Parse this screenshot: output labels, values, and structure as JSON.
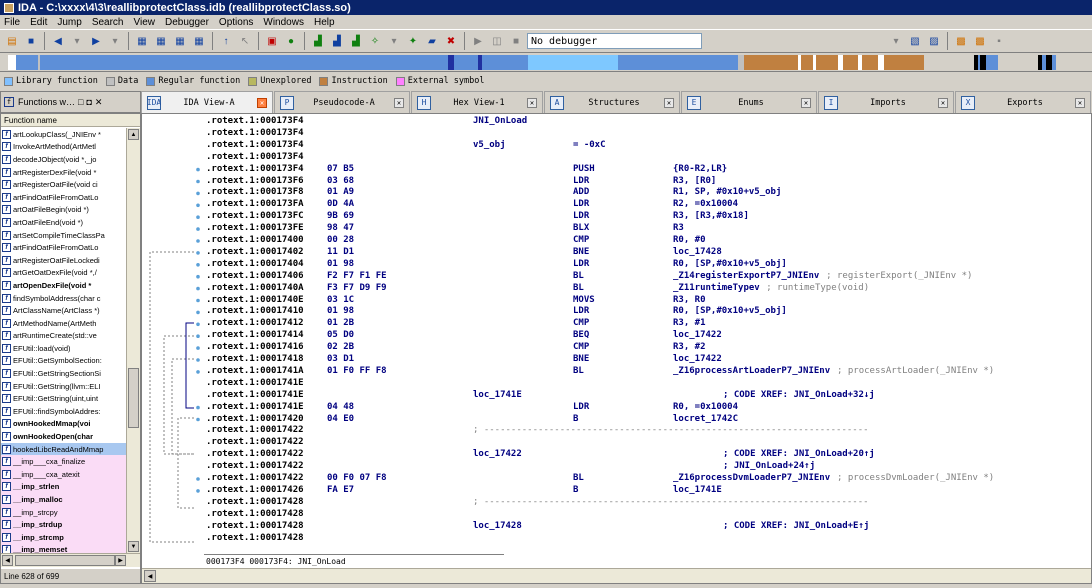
{
  "window": {
    "title": "IDA - C:\\xxxx\\4\\3\\reallibprotectClass.idb (reallibprotectClass.so)"
  },
  "menu": [
    "File",
    "Edit",
    "Jump",
    "Search",
    "View",
    "Debugger",
    "Options",
    "Windows",
    "Help"
  ],
  "toolbar": {
    "debugger_select": "No debugger"
  },
  "legend": [
    {
      "label": "Library function",
      "color": "#80c0ff"
    },
    {
      "label": "Data",
      "color": "#c0c0c0"
    },
    {
      "label": "Regular function",
      "color": "#5d8fd8"
    },
    {
      "label": "Unexplored",
      "color": "#b8b860"
    },
    {
      "label": "Instruction",
      "color": "#c08040"
    },
    {
      "label": "External symbol",
      "color": "#ff80ff"
    }
  ],
  "functions_panel": {
    "title": "Functions w…",
    "column": "Function name",
    "status": "Line 628 of 699",
    "items": [
      {
        "name": "artLookupClass(_JNIEnv *",
        "style": ""
      },
      {
        "name": "InvokeArtMethod(ArtMetl",
        "style": ""
      },
      {
        "name": "decodeJObject(void *,_jo",
        "style": ""
      },
      {
        "name": "artRegisterDexFile(void *",
        "style": ""
      },
      {
        "name": "artRegisterOatFile(void ci",
        "style": ""
      },
      {
        "name": "artFindOatFileFromOatLo",
        "style": ""
      },
      {
        "name": "artOatFileBegin(void *)",
        "style": ""
      },
      {
        "name": "artOatFileEnd(void *)",
        "style": ""
      },
      {
        "name": "artSetCompileTimeClassPa",
        "style": ""
      },
      {
        "name": "artFindOatFileFromOatLo",
        "style": ""
      },
      {
        "name": "artRegisterOatFileLockedi",
        "style": ""
      },
      {
        "name": "artGetOatDexFile(void *,/",
        "style": ""
      },
      {
        "name": "artOpenDexFile(void *",
        "style": "bold"
      },
      {
        "name": "findSymbolAddress(char c",
        "style": ""
      },
      {
        "name": "ArtClassName(ArtClass *)",
        "style": ""
      },
      {
        "name": "ArtMethodName(ArtMeth",
        "style": ""
      },
      {
        "name": "artRuntimeCreate(std::ve",
        "style": ""
      },
      {
        "name": "EFUtil::load(void)",
        "style": ""
      },
      {
        "name": "EFUtil::GetSymbolSection:",
        "style": ""
      },
      {
        "name": "EFUtil::GetStringSectionSi",
        "style": ""
      },
      {
        "name": "EFUtil::GetString(llvm::ELI",
        "style": ""
      },
      {
        "name": "EFUtil::GetString(uint,uint",
        "style": ""
      },
      {
        "name": "EFUtil::findSymbolAddres:",
        "style": ""
      },
      {
        "name": "ownHookedMmap(voi",
        "style": "bold"
      },
      {
        "name": "ownHookedOpen(char",
        "style": "bold"
      },
      {
        "name": "hookedLibcReadAndMmap",
        "style": "sel"
      },
      {
        "name": "__imp___cxa_finalize",
        "style": "lib"
      },
      {
        "name": "__imp___cxa_atexit",
        "style": "lib"
      },
      {
        "name": "__imp_strlen",
        "style": "lib bold"
      },
      {
        "name": "__imp_malloc",
        "style": "lib bold"
      },
      {
        "name": "__imp_strcpy",
        "style": "lib"
      },
      {
        "name": "__imp_strdup",
        "style": "lib bold"
      },
      {
        "name": "__imp_strcmp",
        "style": "lib bold"
      },
      {
        "name": "__imp_memset",
        "style": "lib bold"
      }
    ]
  },
  "tabs": [
    {
      "label": "IDA View-A",
      "icon": "IDA",
      "close_active": true
    },
    {
      "label": "Pseudocode-A",
      "icon": "P",
      "close_active": false
    },
    {
      "label": "Hex View-1",
      "icon": "H",
      "close_active": false
    },
    {
      "label": "Structures",
      "icon": "A",
      "close_active": false
    },
    {
      "label": "Enums",
      "icon": "E",
      "close_active": false
    },
    {
      "label": "Imports",
      "icon": "I",
      "close_active": false
    },
    {
      "label": "Exports",
      "icon": "X",
      "close_active": false
    }
  ],
  "disasm": [
    {
      "addr": ".rotext.1:000173F4",
      "bytes": "",
      "label": "JNI_OnLoad",
      "mn": "",
      "op": "",
      "cmt": ""
    },
    {
      "addr": ".rotext.1:000173F4",
      "bytes": "",
      "label": "",
      "mn": "",
      "op": "",
      "cmt": ""
    },
    {
      "addr": ".rotext.1:000173F4",
      "bytes": "",
      "label": "v5_obj",
      "mn": "= -0xC",
      "op": "",
      "cmt": ""
    },
    {
      "addr": ".rotext.1:000173F4",
      "bytes": "",
      "label": "",
      "mn": "",
      "op": "",
      "cmt": ""
    },
    {
      "addr": ".rotext.1:000173F4",
      "bytes": "07 B5",
      "label": "",
      "mn": "PUSH",
      "op": "{R0-R2,LR}",
      "cmt": ""
    },
    {
      "addr": ".rotext.1:000173F6",
      "bytes": "03 68",
      "label": "",
      "mn": "LDR",
      "op": "R3, [R0]",
      "cmt": ""
    },
    {
      "addr": ".rotext.1:000173F8",
      "bytes": "01 A9",
      "label": "",
      "mn": "ADD",
      "op": "R1, SP, #0x10+v5_obj",
      "cmt": ""
    },
    {
      "addr": ".rotext.1:000173FA",
      "bytes": "0D 4A",
      "label": "",
      "mn": "LDR",
      "op": "R2, =0x10004",
      "cmt": ""
    },
    {
      "addr": ".rotext.1:000173FC",
      "bytes": "9B 69",
      "label": "",
      "mn": "LDR",
      "op": "R3, [R3,#0x18]",
      "cmt": ""
    },
    {
      "addr": ".rotext.1:000173FE",
      "bytes": "98 47",
      "label": "",
      "mn": "BLX",
      "op": "R3",
      "cmt": ""
    },
    {
      "addr": ".rotext.1:00017400",
      "bytes": "00 28",
      "label": "",
      "mn": "CMP",
      "op": "R0, #0",
      "cmt": ""
    },
    {
      "addr": ".rotext.1:00017402",
      "bytes": "11 D1",
      "label": "",
      "mn": "BNE",
      "op": "loc_17428",
      "cmt": ""
    },
    {
      "addr": ".rotext.1:00017404",
      "bytes": "01 98",
      "label": "",
      "mn": "LDR",
      "op": "R0, [SP,#0x10+v5_obj]",
      "cmt": ""
    },
    {
      "addr": ".rotext.1:00017406",
      "bytes": "F2 F7 F1 FE",
      "label": "",
      "mn": "BL",
      "op": "_Z14registerExportP7_JNIEnv",
      "cmt": "; registerExport(_JNIEnv *)"
    },
    {
      "addr": ".rotext.1:0001740A",
      "bytes": "F3 F7 D9 F9",
      "label": "",
      "mn": "BL",
      "op": "_Z11runtimeTypev",
      "cmt": "; runtimeType(void)"
    },
    {
      "addr": ".rotext.1:0001740E",
      "bytes": "03 1C",
      "label": "",
      "mn": "MOVS",
      "op": "R3, R0",
      "cmt": ""
    },
    {
      "addr": ".rotext.1:00017410",
      "bytes": "01 98",
      "label": "",
      "mn": "LDR",
      "op": "R0, [SP,#0x10+v5_obj]",
      "cmt": ""
    },
    {
      "addr": ".rotext.1:00017412",
      "bytes": "01 2B",
      "label": "",
      "mn": "CMP",
      "op": "R3, #1",
      "cmt": ""
    },
    {
      "addr": ".rotext.1:00017414",
      "bytes": "05 D0",
      "label": "",
      "mn": "BEQ",
      "op": "loc_17422",
      "cmt": ""
    },
    {
      "addr": ".rotext.1:00017416",
      "bytes": "02 2B",
      "label": "",
      "mn": "CMP",
      "op": "R3, #2",
      "cmt": ""
    },
    {
      "addr": ".rotext.1:00017418",
      "bytes": "03 D1",
      "label": "",
      "mn": "BNE",
      "op": "loc_17422",
      "cmt": ""
    },
    {
      "addr": ".rotext.1:0001741A",
      "bytes": "01 F0 FF F8",
      "label": "",
      "mn": "BL",
      "op": "_Z16processArtLoaderP7_JNIEnv",
      "cmt": "; processArtLoader(_JNIEnv *)"
    },
    {
      "addr": ".rotext.1:0001741E",
      "bytes": "",
      "label": "",
      "mn": "",
      "op": "",
      "cmt": ""
    },
    {
      "addr": ".rotext.1:0001741E",
      "bytes": "",
      "label": "loc_1741E",
      "mn": "",
      "op": "",
      "cmt": "",
      "xref": "; CODE XREF: JNI_OnLoad+32↓j"
    },
    {
      "addr": ".rotext.1:0001741E",
      "bytes": "04 48",
      "label": "",
      "mn": "LDR",
      "op": "R0, =0x10004",
      "cmt": ""
    },
    {
      "addr": ".rotext.1:00017420",
      "bytes": "04 E0",
      "label": "",
      "mn": "B",
      "op": "locret_1742C",
      "cmt": ""
    },
    {
      "addr": ".rotext.1:00017422",
      "bytes": "",
      "label": "",
      "mn": "",
      "op": "",
      "cmt": "",
      "sep": true
    },
    {
      "addr": ".rotext.1:00017422",
      "bytes": "",
      "label": "",
      "mn": "",
      "op": "",
      "cmt": ""
    },
    {
      "addr": ".rotext.1:00017422",
      "bytes": "",
      "label": "loc_17422",
      "mn": "",
      "op": "",
      "cmt": "",
      "xref": "; CODE XREF: JNI_OnLoad+20↑j"
    },
    {
      "addr": ".rotext.1:00017422",
      "bytes": "",
      "label": "",
      "mn": "",
      "op": "",
      "cmt": "",
      "xref": "; JNI_OnLoad+24↑j"
    },
    {
      "addr": ".rotext.1:00017422",
      "bytes": "00 F0 07 F8",
      "label": "",
      "mn": "BL",
      "op": "_Z16processDvmLoaderP7_JNIEnv",
      "cmt": "; processDvmLoader(_JNIEnv *)"
    },
    {
      "addr": ".rotext.1:00017426",
      "bytes": "FA E7",
      "label": "",
      "mn": "B",
      "op": "loc_1741E",
      "cmt": ""
    },
    {
      "addr": ".rotext.1:00017428",
      "bytes": "",
      "label": "",
      "mn": "",
      "op": "",
      "cmt": "",
      "sep": true
    },
    {
      "addr": ".rotext.1:00017428",
      "bytes": "",
      "label": "",
      "mn": "",
      "op": "",
      "cmt": ""
    },
    {
      "addr": ".rotext.1:00017428",
      "bytes": "",
      "label": "loc_17428",
      "mn": "",
      "op": "",
      "cmt": "",
      "xref": "; CODE XREF: JNI_OnLoad+E↑j"
    },
    {
      "addr": ".rotext.1:00017428",
      "bytes": "",
      "label": "",
      "mn": "",
      "op": "",
      "cmt": ""
    }
  ],
  "status_address": "000173F4 000173F4: JNI_OnLoad"
}
